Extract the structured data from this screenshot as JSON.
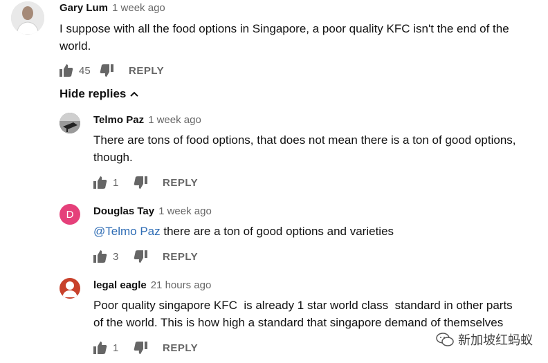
{
  "comments": [
    {
      "author": "Gary Lum",
      "time": "1 week ago",
      "text_lines": [
        "I suppose with all the food options in Singapore, a poor quality KFC isn't the end of the",
        "world."
      ],
      "likes": "45",
      "reply_label": "REPLY"
    }
  ],
  "hide_replies_label": "Hide replies",
  "replies": [
    {
      "author": "Telmo Paz",
      "time": "1 week ago",
      "text_lines": [
        "There are tons of food options, that does not mean there is a ton of good options,",
        "though."
      ],
      "likes": "1",
      "reply_label": "REPLY"
    },
    {
      "author": "Douglas Tay",
      "time": "1 week ago",
      "avatar_letter": "D",
      "avatar_color": "#e5407a",
      "mention": "@Telmo Paz",
      "text_after_mention": " there are a ton of good options and varieties",
      "likes": "3",
      "reply_label": "REPLY"
    },
    {
      "author": "legal eagle",
      "time": "21 hours ago",
      "avatar_color": "#c8412b",
      "text_lines": [
        "Poor quality singapore KFC  is already 1 star world class  standard in other parts",
        "of the world. This is how high a standard that singapore demand of themselves"
      ],
      "likes": "1",
      "reply_label": "REPLY"
    }
  ],
  "watermark": {
    "text": "新加坡红蚂蚁",
    "icon": "wechat-icon"
  }
}
